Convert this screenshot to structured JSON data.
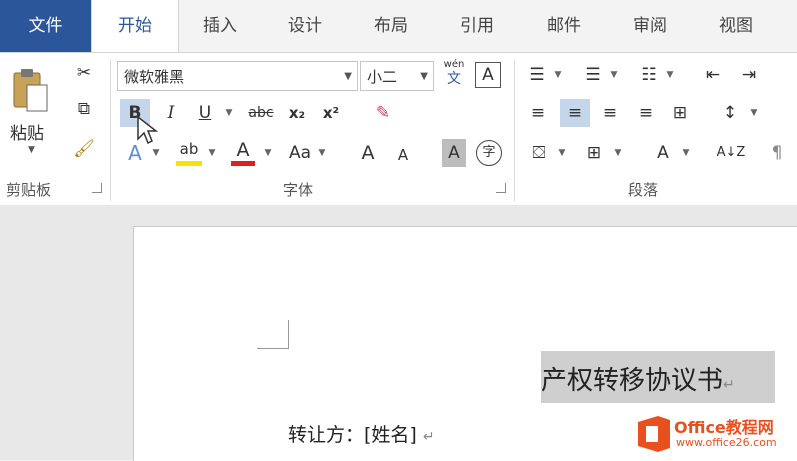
{
  "tabs": [
    "文件",
    "开始",
    "插入",
    "设计",
    "布局",
    "引用",
    "邮件",
    "审阅",
    "视图"
  ],
  "clipboard": {
    "paste_label": "粘贴",
    "group_label": "剪贴板"
  },
  "font": {
    "name": "微软雅黑",
    "size": "小二",
    "pinyin_top": "wén",
    "pinyin_bottom": "文",
    "border_char": "A",
    "bold": "B",
    "italic": "I",
    "underline": "U",
    "strike": "abc",
    "subscript": "x₂",
    "superscript": "x²",
    "case": "Aa",
    "grow": "A",
    "shrink": "A",
    "shade_char": "A",
    "enclose_char": "字",
    "group_label": "字体"
  },
  "paragraph": {
    "group_label": "段落",
    "sort_label": "A↓Z"
  },
  "document": {
    "title": "产权转移协议书",
    "para_mark": "↵",
    "line1_label": "转让方：[姓名]",
    "line1_mark": "↵"
  },
  "watermark": {
    "name": "Office教程网",
    "url": "www.office26.com"
  },
  "colors": {
    "file_tab": "#2b579a",
    "highlight": "#f5e300",
    "font_color": "#e02020",
    "selection": "#cfcfcf"
  }
}
